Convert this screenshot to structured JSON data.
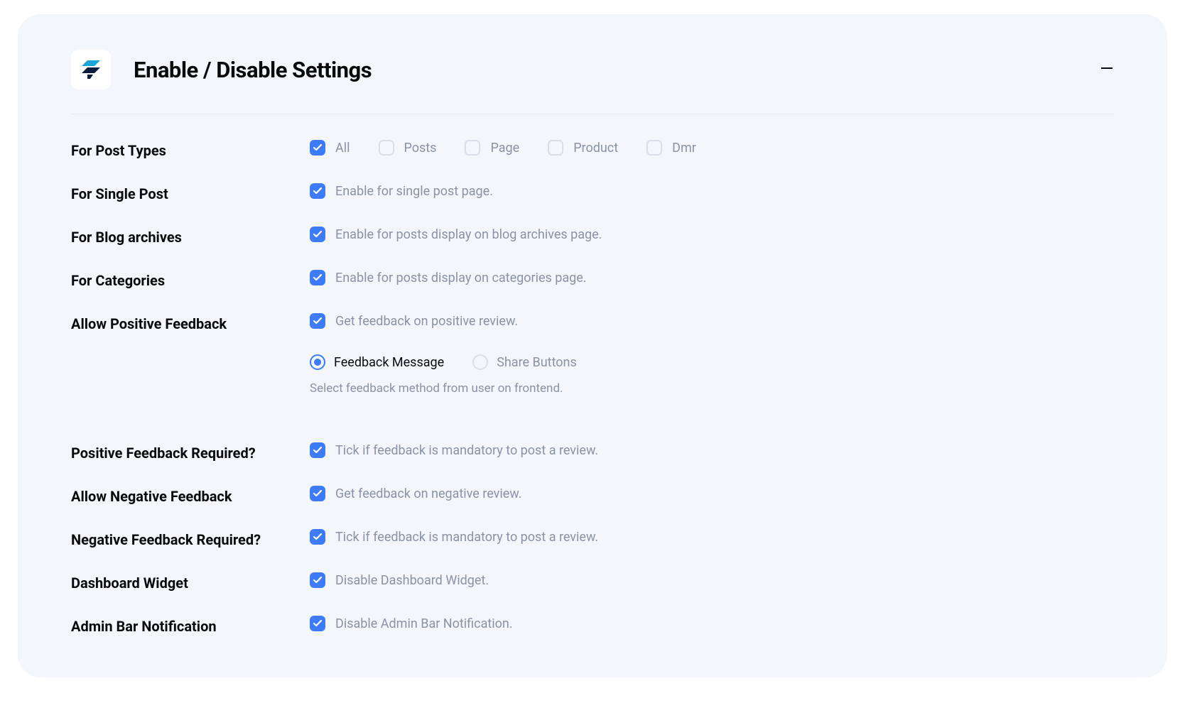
{
  "header": {
    "title": "Enable / Disable Settings"
  },
  "settings": {
    "post_types": {
      "label": "For Post Types",
      "options": [
        {
          "label": "All",
          "checked": true
        },
        {
          "label": "Posts",
          "checked": false
        },
        {
          "label": "Page",
          "checked": false
        },
        {
          "label": "Product",
          "checked": false
        },
        {
          "label": "Dmr",
          "checked": false
        }
      ]
    },
    "single_post": {
      "label": "For Single Post",
      "checked": true,
      "text": "Enable for single post page."
    },
    "blog_archives": {
      "label": "For Blog archives",
      "checked": true,
      "text": "Enable for posts display on blog archives page."
    },
    "categories": {
      "label": "For Categories",
      "checked": true,
      "text": "Enable for posts display on categories page."
    },
    "allow_positive": {
      "label": "Allow Positive Feedback",
      "checked": true,
      "text": "Get feedback on positive review.",
      "radio": {
        "options": [
          {
            "label": "Feedback Message",
            "selected": true
          },
          {
            "label": "Share Buttons",
            "selected": false
          }
        ],
        "hint": "Select feedback method from user on frontend."
      }
    },
    "positive_required": {
      "label": "Positive Feedback Required?",
      "checked": true,
      "text": "Tick if feedback is mandatory to post a review."
    },
    "allow_negative": {
      "label": "Allow Negative Feedback",
      "checked": true,
      "text": "Get feedback on negative review."
    },
    "negative_required": {
      "label": "Negative Feedback Required?",
      "checked": true,
      "text": "Tick if feedback is mandatory to post a review."
    },
    "dashboard_widget": {
      "label": "Dashboard Widget",
      "checked": true,
      "text": "Disable Dashboard Widget."
    },
    "admin_bar": {
      "label": "Admin Bar Notification",
      "checked": true,
      "text": "Disable Admin Bar Notification."
    }
  }
}
